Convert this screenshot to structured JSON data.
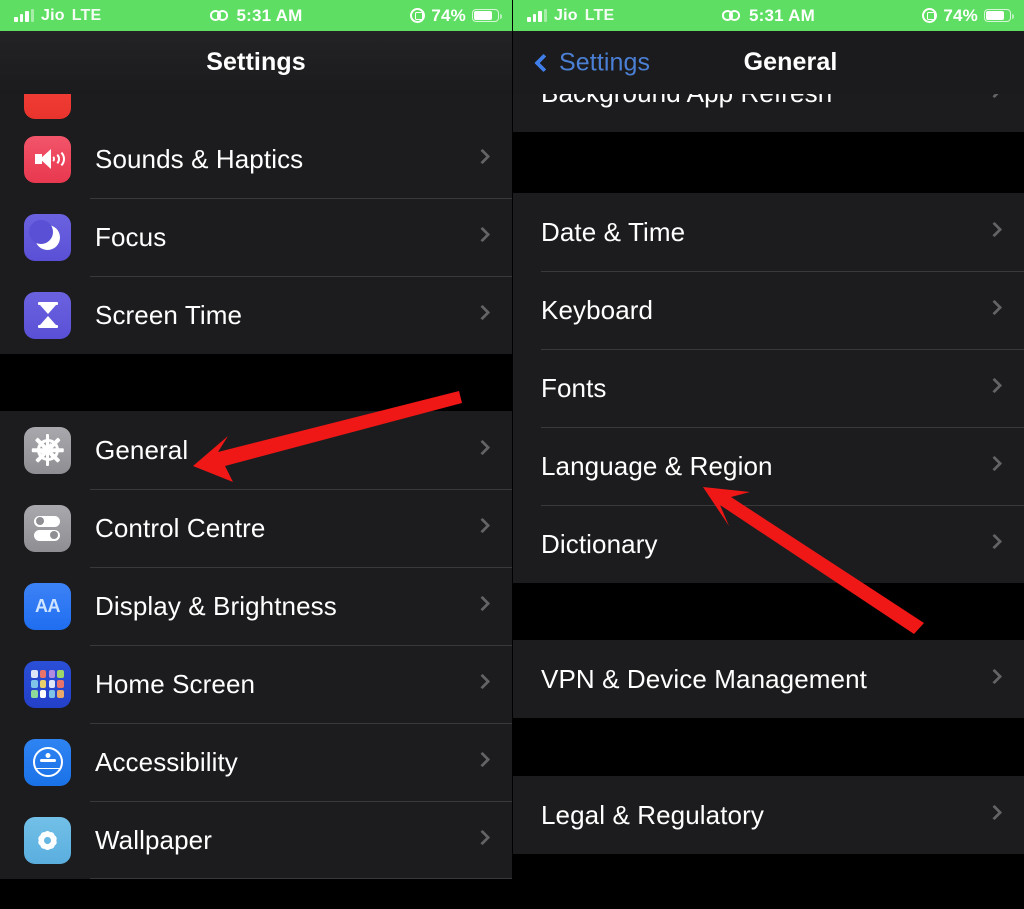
{
  "statusbar": {
    "signal_icon": "cellular-bars-icon",
    "carrier": "Jio",
    "network": "LTE",
    "recording_icon": "screen-record-link-icon",
    "time": "5:31 AM",
    "rotation_lock_icon": "rotation-lock-icon",
    "battery_percent": "74%",
    "battery_icon": "battery-icon",
    "background_color": "#5ede62"
  },
  "left_panel": {
    "nav": {
      "title": "Settings"
    },
    "partial_top_item": {
      "label": "",
      "icon": "notifications-icon",
      "icon_color": "#e8342c"
    },
    "groups": [
      {
        "rows": [
          {
            "label": "Sounds & Haptics",
            "icon": "speaker-icon",
            "icon_color": "#e8384f"
          },
          {
            "label": "Focus",
            "icon": "moon-icon",
            "icon_color": "#5a50d6"
          },
          {
            "label": "Screen Time",
            "icon": "hourglass-icon",
            "icon_color": "#5a50d6"
          }
        ]
      },
      {
        "rows": [
          {
            "label": "General",
            "icon": "gear-icon",
            "icon_color": "#8e8e93"
          },
          {
            "label": "Control Centre",
            "icon": "toggles-icon",
            "icon_color": "#8e8e93"
          },
          {
            "label": "Display & Brightness",
            "icon": "aa-text-icon",
            "icon_color": "#1f6ef0"
          },
          {
            "label": "Home Screen",
            "icon": "app-grid-icon",
            "icon_color": "#2340c9"
          },
          {
            "label": "Accessibility",
            "icon": "accessibility-icon",
            "icon_color": "#1a72e8"
          },
          {
            "label": "Wallpaper",
            "icon": "flower-icon",
            "icon_color": "#5aaede"
          }
        ]
      }
    ]
  },
  "right_panel": {
    "nav": {
      "back_label": "Settings",
      "title": "General",
      "back_icon": "chevron-left-icon",
      "back_color": "#3f7ee8"
    },
    "groups": [
      {
        "rows": [
          {
            "label": "Background App Refresh"
          }
        ]
      },
      {
        "rows": [
          {
            "label": "Date & Time"
          },
          {
            "label": "Keyboard"
          },
          {
            "label": "Fonts"
          },
          {
            "label": "Language & Region"
          },
          {
            "label": "Dictionary"
          }
        ]
      },
      {
        "rows": [
          {
            "label": "VPN & Device Management"
          }
        ]
      },
      {
        "rows": [
          {
            "label": "Legal & Regulatory"
          }
        ]
      }
    ]
  },
  "annotations": {
    "arrow_color": "#f01717",
    "arrows": [
      {
        "name": "arrow-pointing-general",
        "target": "General"
      },
      {
        "name": "arrow-pointing-language-region",
        "target": "Language & Region"
      }
    ]
  },
  "chevron_icon": "chevron-right-icon"
}
